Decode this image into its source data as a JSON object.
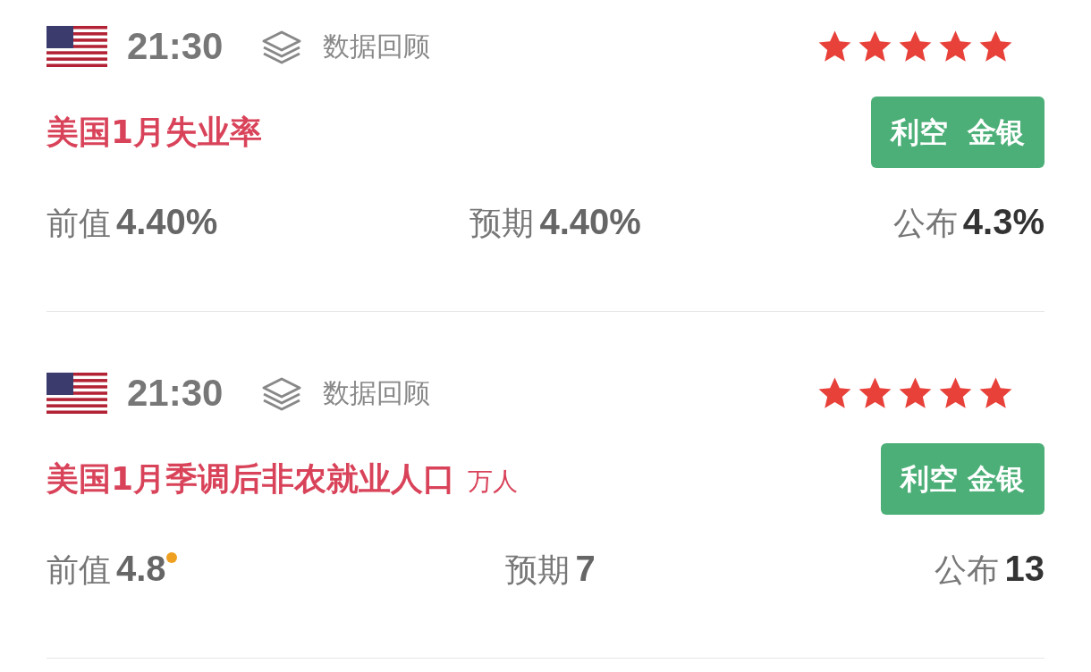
{
  "events": [
    {
      "time": "21:30",
      "review": "数据回顾",
      "stars": 5,
      "title": "美国1月失业率",
      "badge": "利空  金银",
      "previous": {
        "label": "前值",
        "value": "4.40%",
        "revised": false
      },
      "forecast": {
        "label": "预期",
        "value": "4.40%"
      },
      "actual": {
        "label": "公布",
        "value": "4.3%"
      }
    },
    {
      "time": "21:30",
      "review": "数据回顾",
      "stars": 5,
      "title": "美国1月季调后非农就业人口",
      "unit": "万人",
      "badge": "利空 金银",
      "previous": {
        "label": "前值",
        "value": "4.8",
        "revised": true
      },
      "forecast": {
        "label": "预期",
        "value": "7"
      },
      "actual": {
        "label": "公布",
        "value": "13"
      }
    }
  ]
}
